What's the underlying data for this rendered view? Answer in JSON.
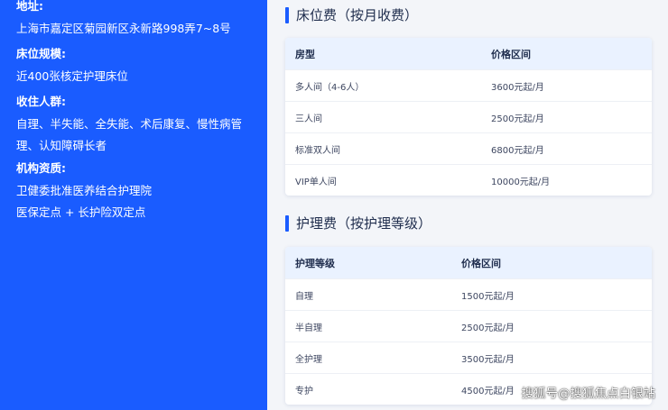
{
  "info": {
    "address_label": "地址:",
    "address": "上海市嘉定区菊园新区永新路998弄7~8号",
    "beds_label": "床位规模:",
    "beds": "近400张核定护理床位",
    "target_label": "收住人群:",
    "target_line1": "自理、半失能、全失能、术后康复、慢性病管",
    "target_line2": "理、认知障碍长者",
    "qual_label": "机构资质:",
    "qual_line1": "卫健委批准医养结合护理院",
    "qual_line2": "医保定点 + 长护险双定点"
  },
  "bed_fee": {
    "title": "床位费（按月收费）",
    "headers": [
      "房型",
      "价格区间"
    ],
    "rows": [
      [
        "多人间（4-6人）",
        "3600元起/月"
      ],
      [
        "三人间",
        "2500元起/月"
      ],
      [
        "标准双人间",
        "6800元起/月"
      ],
      [
        "VIP单人间",
        "10000元起/月"
      ]
    ]
  },
  "care_fee": {
    "title": "护理费（按护理等级）",
    "headers": [
      "护理等级",
      "价格区间"
    ],
    "rows": [
      [
        "自理",
        "1500元起/月"
      ],
      [
        "半自理",
        "2500元起/月"
      ],
      [
        "全护理",
        "3500元起/月"
      ],
      [
        "专护",
        "4500元起/月"
      ]
    ]
  },
  "watermark": "搜狐号@搜狐焦点白银站",
  "colors": {
    "accent": "#1a5cff",
    "table_header": "#eaf2ff",
    "text_dark": "#1f2d4d"
  }
}
